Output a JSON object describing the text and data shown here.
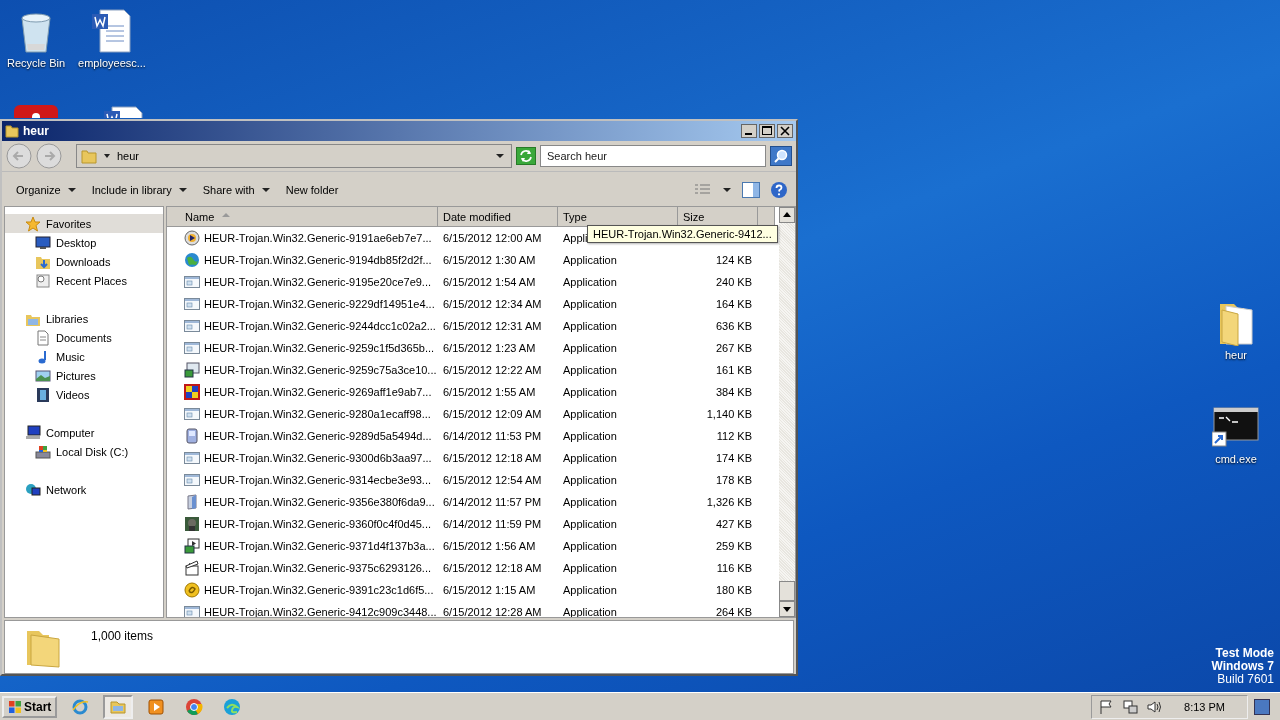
{
  "desktop": {
    "icons": [
      {
        "label": "Recycle Bin",
        "kind": "recycle"
      },
      {
        "label": "employeesc...",
        "kind": "word"
      },
      {
        "label": "heur",
        "kind": "folder"
      },
      {
        "label": "cmd.exe",
        "kind": "cmd"
      }
    ],
    "os_notice": [
      "Test Mode",
      "Windows 7",
      "Build 7601"
    ]
  },
  "window": {
    "title": "heur",
    "address": {
      "crumbs": [
        "heur"
      ]
    },
    "search": {
      "placeholder": "Search heur"
    },
    "toolbar": [
      {
        "label": "Organize",
        "dropdown": true
      },
      {
        "label": "Include in library",
        "dropdown": true
      },
      {
        "label": "Share with",
        "dropdown": true
      },
      {
        "label": "New folder",
        "dropdown": false
      }
    ],
    "nav": [
      {
        "label": "Favorites",
        "selected": true,
        "children": [
          {
            "label": "Desktop",
            "selected": false
          },
          {
            "label": "Downloads",
            "selected": false
          },
          {
            "label": "Recent Places",
            "selected": false
          }
        ]
      },
      {
        "label": "Libraries",
        "selected": false,
        "children": [
          {
            "label": "Documents",
            "selected": false
          },
          {
            "label": "Music",
            "selected": false
          },
          {
            "label": "Pictures",
            "selected": false
          },
          {
            "label": "Videos",
            "selected": false
          }
        ]
      },
      {
        "label": "Computer",
        "selected": false,
        "children": [
          {
            "label": "Local Disk (C:)",
            "selected": false
          }
        ]
      },
      {
        "label": "Network",
        "selected": false
      }
    ],
    "table": {
      "columns": [
        {
          "label": "Name",
          "sorted": true
        },
        {
          "label": "Date modified",
          "sorted": false
        },
        {
          "label": "Type",
          "sorted": false
        },
        {
          "label": "Size",
          "sorted": false
        }
      ],
      "rows": [
        {
          "name": "HEUR-Trojan.Win32.Generic-9191ae6eb7e7...",
          "date": "6/15/2012 12:00 AM",
          "type": "Appli"
        },
        {
          "name": "HEUR-Trojan.Win32.Generic-9194db85f2d2f...",
          "date": "6/15/2012 1:30 AM",
          "type": "Application",
          "size": "124 KB"
        },
        {
          "name": "HEUR-Trojan.Win32.Generic-9195e20ce7e9...",
          "date": "6/15/2012 1:54 AM",
          "type": "Application",
          "size": "240 KB"
        },
        {
          "name": "HEUR-Trojan.Win32.Generic-9229df14951e4...",
          "date": "6/15/2012 12:34 AM",
          "type": "Application",
          "size": "164 KB"
        },
        {
          "name": "HEUR-Trojan.Win32.Generic-9244dcc1c02a2...",
          "date": "6/15/2012 12:31 AM",
          "type": "Application",
          "size": "636 KB"
        },
        {
          "name": "HEUR-Trojan.Win32.Generic-9259c1f5d365b...",
          "date": "6/15/2012 1:23 AM",
          "type": "Application",
          "size": "267 KB"
        },
        {
          "name": "HEUR-Trojan.Win32.Generic-9259c75a3ce10...",
          "date": "6/15/2012 12:22 AM",
          "type": "Application",
          "size": "161 KB"
        },
        {
          "name": "HEUR-Trojan.Win32.Generic-9269aff1e9ab7...",
          "date": "6/15/2012 1:55 AM",
          "type": "Application",
          "size": "384 KB"
        },
        {
          "name": "HEUR-Trojan.Win32.Generic-9280a1ecaff98...",
          "date": "6/15/2012 12:09 AM",
          "type": "Application",
          "size": "1,140 KB"
        },
        {
          "name": "HEUR-Trojan.Win32.Generic-9289d5a5494d...",
          "date": "6/14/2012 11:53 PM",
          "type": "Application",
          "size": "112 KB"
        },
        {
          "name": "HEUR-Trojan.Win32.Generic-9300d6b3aa97...",
          "date": "6/15/2012 12:18 AM",
          "type": "Application",
          "size": "174 KB"
        },
        {
          "name": "HEUR-Trojan.Win32.Generic-9314ecbe3e93...",
          "date": "6/15/2012 12:54 AM",
          "type": "Application",
          "size": "178 KB"
        },
        {
          "name": "HEUR-Trojan.Win32.Generic-9356e380f6da9...",
          "date": "6/14/2012 11:57 PM",
          "type": "Application",
          "size": "1,326 KB"
        },
        {
          "name": "HEUR-Trojan.Win32.Generic-9360f0c4f0d45...",
          "date": "6/14/2012 11:59 PM",
          "type": "Application",
          "size": "427 KB"
        },
        {
          "name": "HEUR-Trojan.Win32.Generic-9371d4f137b3a...",
          "date": "6/15/2012 1:56 AM",
          "type": "Application",
          "size": "259 KB"
        },
        {
          "name": "HEUR-Trojan.Win32.Generic-9375c6293126...",
          "date": "6/15/2012 12:18 AM",
          "type": "Application",
          "size": "116 KB"
        },
        {
          "name": "HEUR-Trojan.Win32.Generic-9391c23c1d6f5...",
          "date": "6/15/2012 1:15 AM",
          "type": "Application",
          "size": "180 KB"
        },
        {
          "name": "HEUR-Trojan.Win32.Generic-9412c909c3448...",
          "date": "6/15/2012 12:28 AM",
          "type": "Application",
          "size": "264 KB"
        }
      ]
    },
    "tooltip": "HEUR-Trojan.Win32.Generic-9412...",
    "status": {
      "text": "1,000 items"
    }
  },
  "taskbar": {
    "start": "Start",
    "apps": [
      {
        "selected": false
      },
      {
        "selected": true
      },
      {
        "selected": false
      },
      {
        "selected": false
      },
      {
        "selected": false
      }
    ],
    "clock": "8:13 PM"
  }
}
